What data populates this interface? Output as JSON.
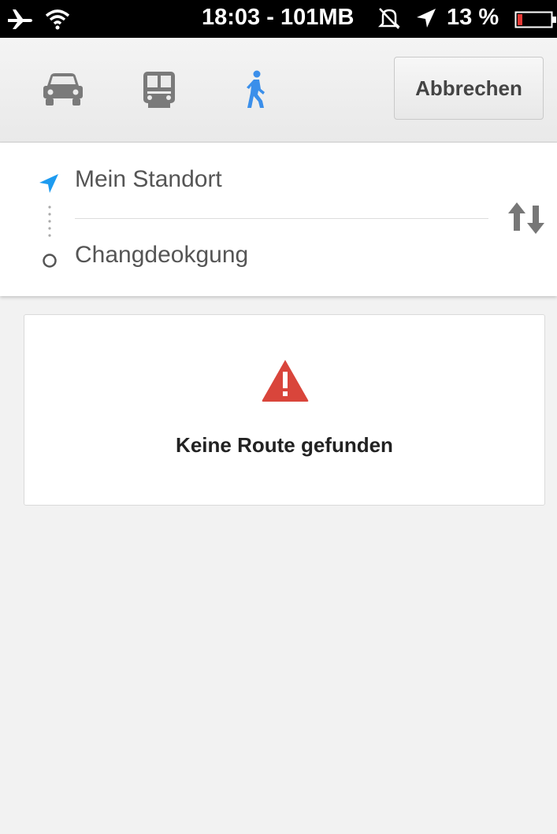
{
  "status_bar": {
    "time_memory": "18:03 - 101MB",
    "battery_percent": "13 %",
    "battery_level": 0.13,
    "icons": [
      "airplane-icon",
      "wifi-icon",
      "mute-bell-icon",
      "location-arrow-icon",
      "battery-icon"
    ]
  },
  "mode_bar": {
    "modes": [
      {
        "name": "car",
        "icon": "car-icon",
        "selected": false
      },
      {
        "name": "transit",
        "icon": "train-icon",
        "selected": false
      },
      {
        "name": "walk",
        "icon": "walking-person-icon",
        "selected": true
      }
    ],
    "cancel_label": "Abbrechen"
  },
  "route": {
    "origin": "Mein Standort",
    "destination": "Changdeokgung",
    "swap_icon": "swap-arrows-icon"
  },
  "result": {
    "warning_icon": "warning-triangle-icon",
    "message": "Keine Route gefunden"
  },
  "colors": {
    "accent_blue": "#3b8fea",
    "location_blue": "#1d9bf0",
    "warning_red": "#d9453b",
    "icon_gray": "#7a7a7a"
  }
}
